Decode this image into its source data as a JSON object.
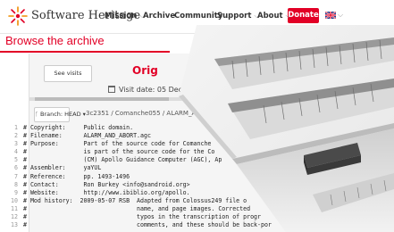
{
  "header": {
    "brand": "Software Heritage",
    "nav": [
      {
        "label": "Mission",
        "chevron": "⌵"
      },
      {
        "label": "Archive",
        "chevron": ""
      },
      {
        "label": "Community",
        "chevron": "⌵"
      },
      {
        "label": "Support",
        "chevron": "⌵"
      },
      {
        "label": "About",
        "chevron": "⌵"
      }
    ],
    "donate": "Donate",
    "flag_icon": "uk-flag-icon",
    "accent_color": "#e20026"
  },
  "page": {
    "title": "Browse the archive"
  },
  "archive": {
    "see_visits": "See visits",
    "origin": "Orig",
    "visit_date": "Visit date: 05 Dece",
    "branch_label": "Branch: HEAD",
    "breadcrumb": "3c2351 / Comanche055 / ALARM_A"
  },
  "code": {
    "lines": [
      {
        "n": "1",
        "t": "# Copyright:     Public domain."
      },
      {
        "n": "2",
        "t": "# Filename:      ALARM_AND_ABORT.agc"
      },
      {
        "n": "3",
        "t": "# Purpose:       Part of the source code for Comanche"
      },
      {
        "n": "4",
        "t": "#                is part of the source code for the Co"
      },
      {
        "n": "5",
        "t": "#                (CM) Apollo Guidance Computer (AGC), Ap"
      },
      {
        "n": "6",
        "t": "# Assembler:     yaYUL"
      },
      {
        "n": "7",
        "t": "# Reference:     pp. 1493-1496"
      },
      {
        "n": "8",
        "t": "# Contact:       Ron Burkey <info@sandroid.org>"
      },
      {
        "n": "9",
        "t": "# Website:       http://www.ibiblio.org/apollo."
      },
      {
        "n": "10",
        "t": "# Mod history:  2009-05-07 RSB  Adapted from Colossus249 file o"
      },
      {
        "n": "11",
        "t": "#                               name, and page images. Corrected"
      },
      {
        "n": "12",
        "t": "#                               typos in the transcription of progr"
      },
      {
        "n": "13",
        "t": "#                               comments, and these should be back-por"
      }
    ]
  }
}
